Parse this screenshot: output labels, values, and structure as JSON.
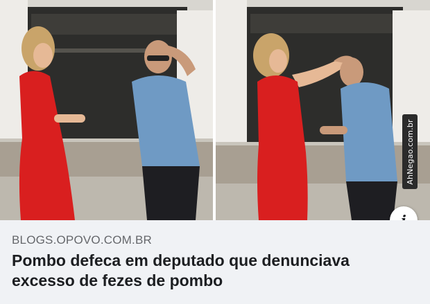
{
  "media": {
    "watermark_text": "AhNegao.com.br",
    "info_icon_glyph": "i",
    "colors": {
      "dress_red": "#d91f1f",
      "shirt_blue": "#6f9ac4",
      "wall_white": "#e9e7e2"
    }
  },
  "link_preview": {
    "domain": "BLOGS.OPOVO.COM.BR",
    "headline": "Pombo defeca em deputado que denunciava excesso de fezes de pombo"
  },
  "colors": {
    "footer_bg": "#f0f2f5",
    "domain_text": "#65676b",
    "headline_text": "#1c1e21"
  }
}
